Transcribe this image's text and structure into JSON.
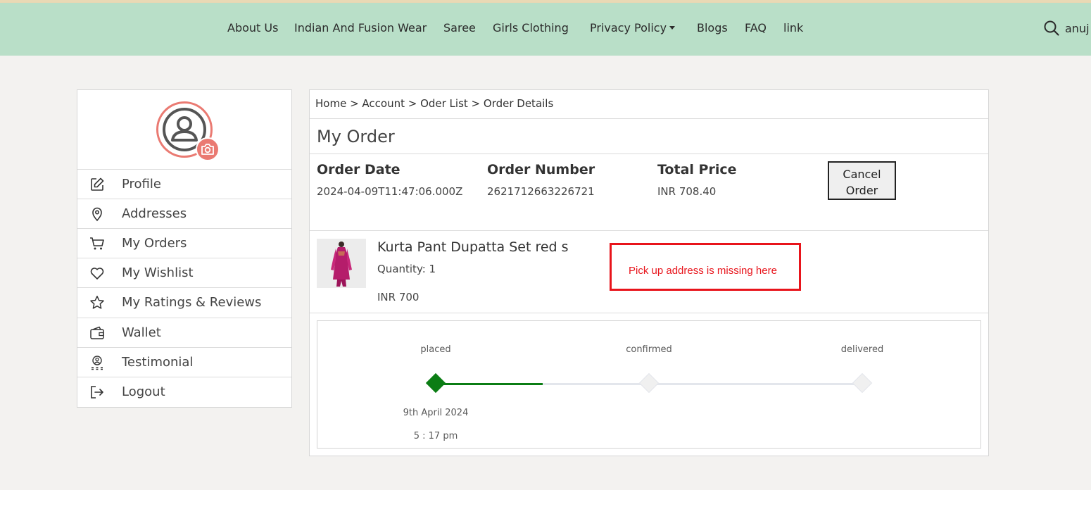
{
  "nav": {
    "items": [
      "About Us",
      "Indian And Fusion Wear",
      "Saree",
      "Girls Clothing",
      "Privacy Policy",
      "Blogs",
      "FAQ",
      "link"
    ],
    "user_partial": "anuj",
    "colors": {
      "bar": "#b9dfc8",
      "topline": "#e9d9b5"
    }
  },
  "sidebar": {
    "items": [
      {
        "label": "Profile",
        "icon": "edit-icon"
      },
      {
        "label": "Addresses",
        "icon": "map-pin-icon"
      },
      {
        "label": "My Orders",
        "icon": "cart-icon"
      },
      {
        "label": "My Wishlist",
        "icon": "heart-icon"
      },
      {
        "label": "My Ratings & Reviews",
        "icon": "star-icon"
      },
      {
        "label": "Wallet",
        "icon": "wallet-icon"
      },
      {
        "label": "Testimonial",
        "icon": "award-icon"
      },
      {
        "label": "Logout",
        "icon": "logout-icon"
      }
    ],
    "accent": "#ea7a72"
  },
  "breadcrumb": "Home > Account > Oder List > Order Details",
  "page_title": "My Order",
  "order": {
    "date_label": "Order Date",
    "date_value": "2024-04-09T11:47:06.000Z",
    "number_label": "Order Number",
    "number_value": "2621712663226721",
    "total_label": "Total Price",
    "total_value": "INR 708.40",
    "cancel_line1": "Cancel",
    "cancel_line2": "Order"
  },
  "product": {
    "name": "Kurta Pant Dupatta Set red s",
    "quantity": "Quantity: 1",
    "price": "INR 700"
  },
  "annotation": "Pick up address is missing here",
  "tracker": {
    "steps": [
      {
        "label": "placed",
        "done": true
      },
      {
        "label": "confirmed",
        "done": false
      },
      {
        "label": "delivered",
        "done": false
      }
    ],
    "placed_date": "9th April 2024",
    "placed_time": "5 : 17 pm",
    "progress": 0.25,
    "colors": {
      "done": "#0b7d14",
      "pending": "#e3e6ec",
      "pending_node": "#f0f0f0"
    }
  }
}
